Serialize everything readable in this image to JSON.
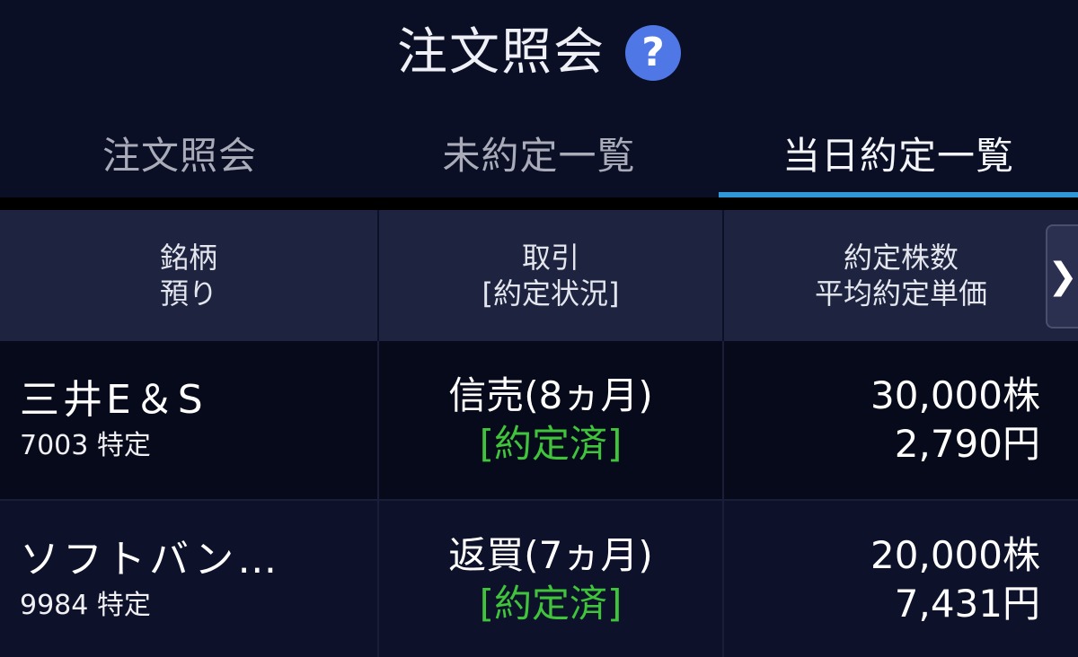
{
  "header": {
    "title": "注文照会",
    "help_icon": "?"
  },
  "tabs": [
    {
      "label": "注文照会",
      "active": false
    },
    {
      "label": "未約定一覧",
      "active": false
    },
    {
      "label": "当日約定一覧",
      "active": true
    }
  ],
  "table": {
    "columns": [
      {
        "line1": "銘柄",
        "line2": "預り"
      },
      {
        "line1": "取引",
        "line2": "[約定状況]"
      },
      {
        "line1": "約定株数",
        "line2": "平均約定単価"
      }
    ],
    "scroll_arrow": "❯",
    "rows": [
      {
        "name": "三井E＆S",
        "sub": "7003 特定",
        "trade_type": "信売(8ヵ月)",
        "status": "[約定済]",
        "quantity": "30,000株",
        "price": "2,790円"
      },
      {
        "name": "ソフトバン…",
        "sub": "9984 特定",
        "trade_type": "返買(7ヵ月)",
        "status": "[約定済]",
        "quantity": "20,000株",
        "price": "7,431円"
      }
    ]
  },
  "colors": {
    "background": "#0b0f26",
    "accent": "#2e98d8",
    "status_green": "#3fc43c",
    "help_blue": "#4f77e6"
  }
}
